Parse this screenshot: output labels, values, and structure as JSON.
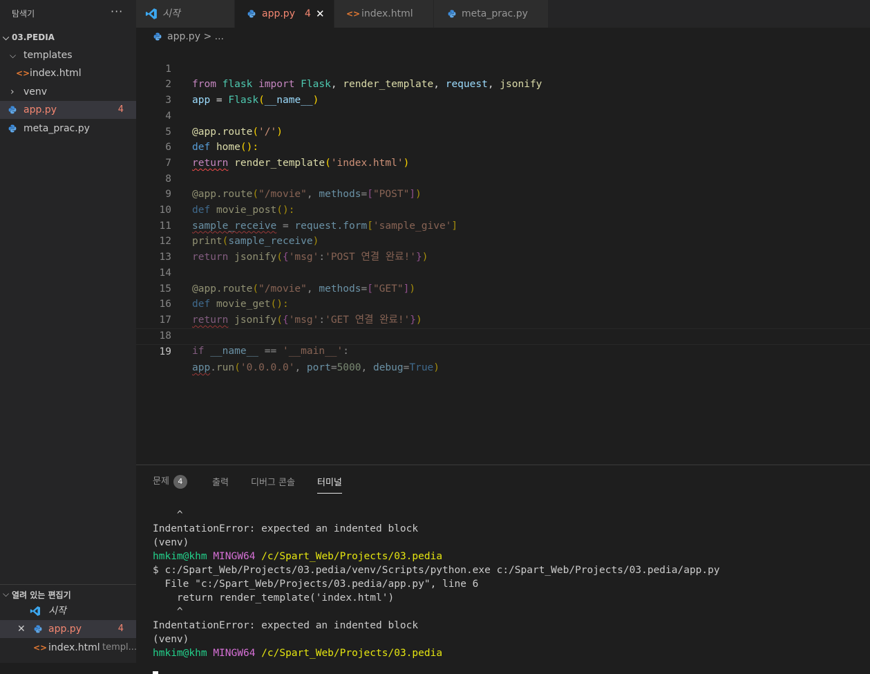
{
  "sidebar": {
    "title": "탐색기",
    "more": "···",
    "folder": "03.PEDIA",
    "tree": [
      {
        "label": "templates"
      },
      {
        "label": "index.html"
      },
      {
        "label": "venv"
      },
      {
        "label": "app.py",
        "badge": "4"
      },
      {
        "label": "meta_prac.py"
      }
    ],
    "open_editors": {
      "title": "열려 있는 편집기",
      "items": [
        {
          "label": "시작"
        },
        {
          "label": "app.py",
          "badge": "4"
        },
        {
          "label": "index.html",
          "desc": "templ..."
        }
      ]
    }
  },
  "tabs": [
    {
      "label": "시작"
    },
    {
      "label": "app.py",
      "badge": "4",
      "close": "✕"
    },
    {
      "label": "index.html"
    },
    {
      "label": "meta_prac.py"
    }
  ],
  "breadcrumb": {
    "file": "app.py",
    "sep": ">",
    "rest": "..."
  },
  "editor": {
    "line_numbers": [
      "1",
      "2",
      "3",
      "4",
      "5",
      "6",
      "7",
      "8",
      "9",
      "10",
      "11",
      "12",
      "13",
      "14",
      "15",
      "16",
      "17",
      "18",
      "19"
    ],
    "l1": {
      "a": "from",
      "b": "flask",
      "c": "import",
      "d": "Flask",
      "e": ", ",
      "f": "render_template",
      "g": ", ",
      "h": "request",
      "i": ", ",
      "j": "jsonify"
    },
    "l2": {
      "a": "app",
      "b": " = ",
      "c": "Flask",
      "d": "(",
      "e": "__name__",
      "f": ")"
    },
    "l4": {
      "a": "@app.route",
      "b": "(",
      "c": "'/'",
      "d": ")"
    },
    "l5": {
      "a": "def",
      "b": "home",
      "c": "():"
    },
    "l6": {
      "a": "return",
      "b": "render_template",
      "c": "(",
      "d": "'index.html'",
      "e": ")"
    },
    "l8": {
      "a": "@app.route",
      "b": "(",
      "c": "\"/movie\"",
      "d": ", ",
      "e": "methods",
      "f": "=",
      "g": "[",
      "h": "\"POST\"",
      "i": "]",
      "j": ")"
    },
    "l9": {
      "a": "def",
      "b": "movie_post",
      "c": "():"
    },
    "l10": {
      "a": "sample_receive",
      "b": " = ",
      "c": "request.form",
      "d": "[",
      "e": "'sample_give'",
      "f": "]"
    },
    "l11": {
      "a": "print",
      "b": "(",
      "c": "sample_receive",
      "d": ")"
    },
    "l12": {
      "a": "return",
      "b": "jsonify",
      "c": "(",
      "d": "{",
      "e": "'msg'",
      "f": ":",
      "g": "'POST 연결 완료!'",
      "h": "}",
      "i": ")"
    },
    "l14": {
      "a": "@app.route",
      "b": "(",
      "c": "\"/movie\"",
      "d": ", ",
      "e": "methods",
      "f": "=",
      "g": "[",
      "h": "\"GET\"",
      "i": "]",
      "j": ")"
    },
    "l15": {
      "a": "def",
      "b": "movie_get",
      "c": "():"
    },
    "l16": {
      "a": "return",
      "b": "jsonify",
      "c": "(",
      "d": "{",
      "e": "'msg'",
      "f": ":",
      "g": "'GET 연결 완료!'",
      "h": "}",
      "i": ")"
    },
    "l18": {
      "a": "if",
      "b": "__name__",
      "c": " == ",
      "d": "'__main__'",
      "e": ":"
    },
    "l19": {
      "a": "app",
      "b": ".",
      "c": "run",
      "d": "(",
      "e": "'0.0.0.0'",
      "f": ", ",
      "g": "port",
      "h": "=",
      "i": "5000",
      "j": ", ",
      "k": "debug",
      "l": "=",
      "m": "True",
      "n": ")"
    }
  },
  "panel": {
    "tabs": {
      "problems": "문제",
      "problems_badge": "4",
      "output": "출력",
      "debug": "디버그 콘솔",
      "terminal": "터미널"
    },
    "terminal_lines": {
      "t1": "    ^",
      "t2": "IndentationError: expected an indented block",
      "t3": "(venv)",
      "t4_user": "hmkim@khm",
      "t4_sys": "MINGW64",
      "t4_path": "/c/Spart_Web/Projects/03.pedia",
      "t5": "$ c:/Spart_Web/Projects/03.pedia/venv/Scripts/python.exe c:/Spart_Web/Projects/03.pedia/app.py",
      "t6": "  File \"c:/Spart_Web/Projects/03.pedia/app.py\", line 6",
      "t7": "    return render_template('index.html')",
      "t8": "    ^",
      "t9": "IndentationError: expected an indented block",
      "t10": "(venv)",
      "t11_user": "hmkim@khm",
      "t11_sys": "MINGW64",
      "t11_path": "/c/Spart_Web/Projects/03.pedia"
    }
  },
  "colors": {
    "error": "#f48771",
    "python_icon": "#3d8ee0",
    "html_icon": "#e37933",
    "vscode_icon": "#3ca7ef"
  }
}
